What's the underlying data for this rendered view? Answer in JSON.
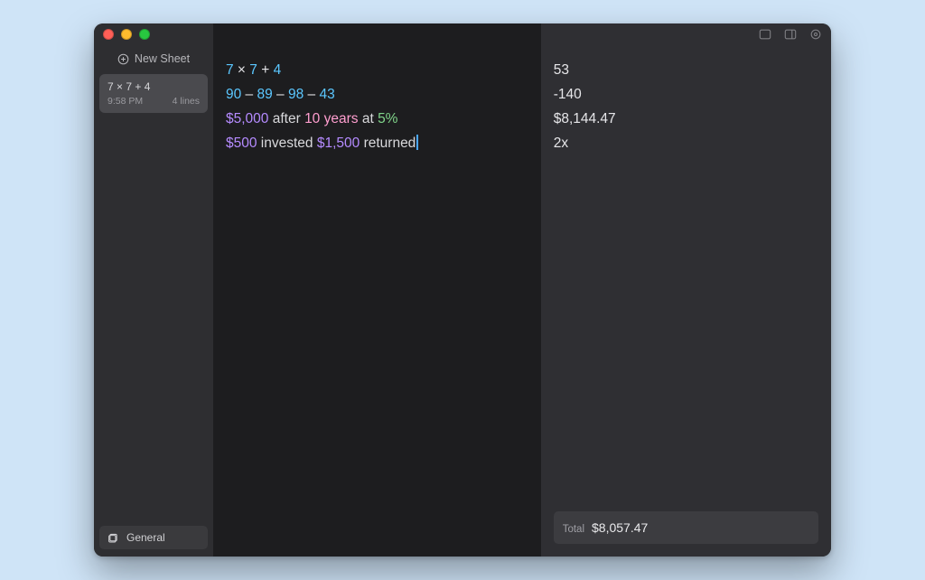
{
  "sidebar": {
    "new_sheet_label": "New Sheet",
    "sheet": {
      "title": "7 × 7 + 4",
      "time": "9:58 PM",
      "lines_label": "4 lines"
    },
    "footer_label": "General"
  },
  "editor_lines": [
    [
      {
        "cls": "tok-num",
        "t": "7"
      },
      {
        "cls": "tok-op",
        "t": " × "
      },
      {
        "cls": "tok-num",
        "t": "7"
      },
      {
        "cls": "tok-op",
        "t": " + "
      },
      {
        "cls": "tok-num",
        "t": "4"
      }
    ],
    [
      {
        "cls": "tok-num",
        "t": "90"
      },
      {
        "cls": "tok-op",
        "t": " – "
      },
      {
        "cls": "tok-num",
        "t": "89"
      },
      {
        "cls": "tok-op",
        "t": " – "
      },
      {
        "cls": "tok-num",
        "t": "98"
      },
      {
        "cls": "tok-op",
        "t": " – "
      },
      {
        "cls": "tok-num",
        "t": "43"
      }
    ],
    [
      {
        "cls": "tok-cur",
        "t": "$5,000"
      },
      {
        "cls": "tok-word",
        "t": " after "
      },
      {
        "cls": "tok-unit",
        "t": "10 years"
      },
      {
        "cls": "tok-word",
        "t": " at "
      },
      {
        "cls": "tok-pct",
        "t": "5%"
      }
    ],
    [
      {
        "cls": "tok-cur",
        "t": "$500"
      },
      {
        "cls": "tok-word",
        "t": " invested "
      },
      {
        "cls": "tok-cur",
        "t": "$1,500"
      },
      {
        "cls": "tok-word",
        "t": " returned"
      }
    ]
  ],
  "results": [
    "53",
    "-140",
    "$8,144.47",
    "2x"
  ],
  "total": {
    "label": "Total",
    "value": "$8,057.47"
  }
}
